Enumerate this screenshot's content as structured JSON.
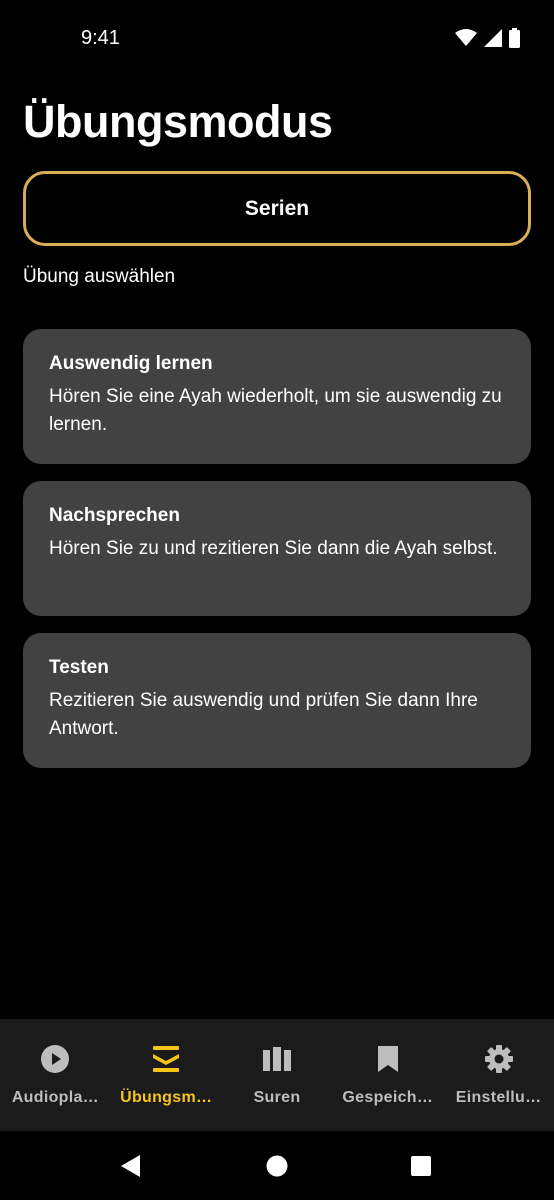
{
  "status_bar": {
    "time": "9:41"
  },
  "header": {
    "title": "Übungsmodus"
  },
  "series_button": {
    "label": "Serien"
  },
  "section_label": "Übung auswählen",
  "cards": [
    {
      "title": "Auswendig lernen",
      "description": "Hören Sie eine Ayah wiederholt, um sie auswendig zu lernen."
    },
    {
      "title": "Nachsprechen",
      "description": "Hören Sie zu und rezitieren Sie dann die Ayah selbst."
    },
    {
      "title": "Testen",
      "description": "Rezitieren Sie auswendig und prüfen Sie dann Ihre Antwort."
    }
  ],
  "bottom_nav": {
    "active_index": 1,
    "items": [
      {
        "label": "Audiopla…",
        "icon": "play-circle-icon"
      },
      {
        "label": "Übungsm…",
        "icon": "practice-stack-icon"
      },
      {
        "label": "Suren",
        "icon": "books-icon"
      },
      {
        "label": "Gespeich…",
        "icon": "bookmark-icon"
      },
      {
        "label": "Einstellu…",
        "icon": "gear-icon"
      }
    ]
  },
  "colors": {
    "background": "#000000",
    "card": "#424242",
    "accent_border": "#d8ae57",
    "active_nav": "#f5c518",
    "inactive_nav": "#bdbdbd",
    "nav_bar": "#1b1b1b"
  }
}
